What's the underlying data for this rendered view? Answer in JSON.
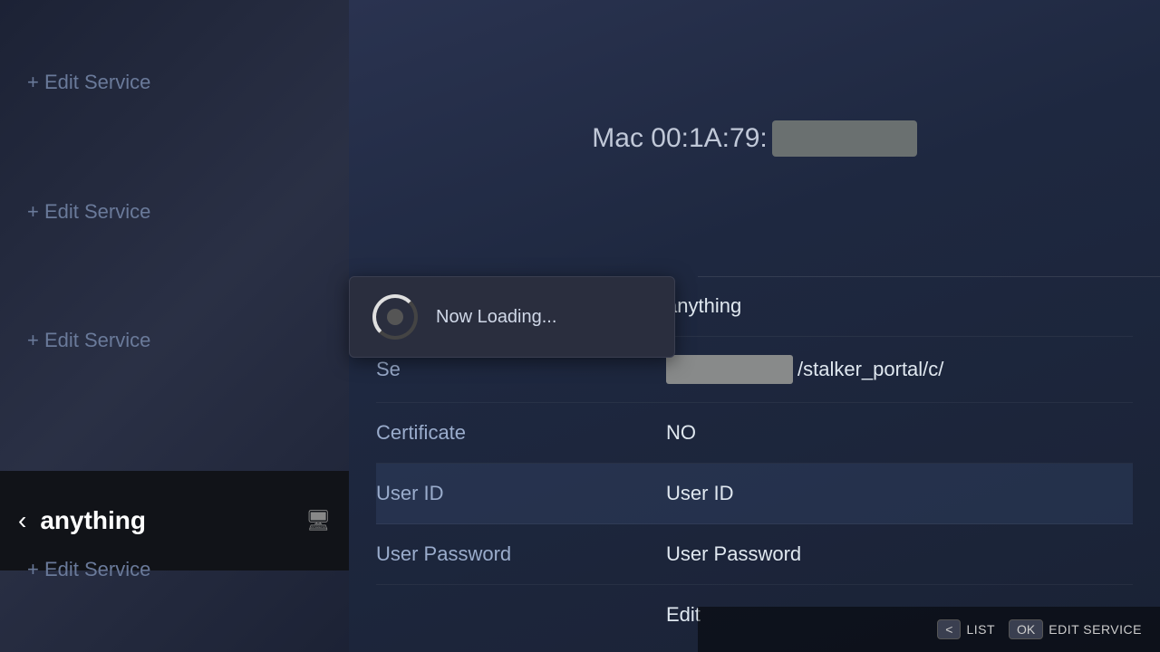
{
  "sidebar": {
    "items": [
      {
        "label": "+ Edit Service",
        "active": false
      },
      {
        "label": "+ Edit Service",
        "active": false
      },
      {
        "label": "+ Edit Service",
        "active": false
      },
      {
        "label": "+ Edit Service",
        "active": false
      }
    ],
    "active_item_label": "anything"
  },
  "main": {
    "mac_prefix": "Mac 00:1A:79:",
    "mac_suffix_hidden": true,
    "service_name_label": "Se",
    "service_name_value": "anything",
    "service_url_label": "Se",
    "service_url_suffix": "/stalker_portal/c/",
    "certificate_label": "Certificate",
    "certificate_value": "NO",
    "user_id_label": "User ID",
    "user_id_value": "User ID",
    "user_password_label": "User Password",
    "user_password_value": "User Password",
    "edit_label": "Edit"
  },
  "loading": {
    "text": "Now Loading..."
  },
  "bottom_bar": {
    "back_key": "<",
    "back_label": "LIST",
    "ok_key": "OK",
    "ok_label": "EDIT SERVICE"
  }
}
